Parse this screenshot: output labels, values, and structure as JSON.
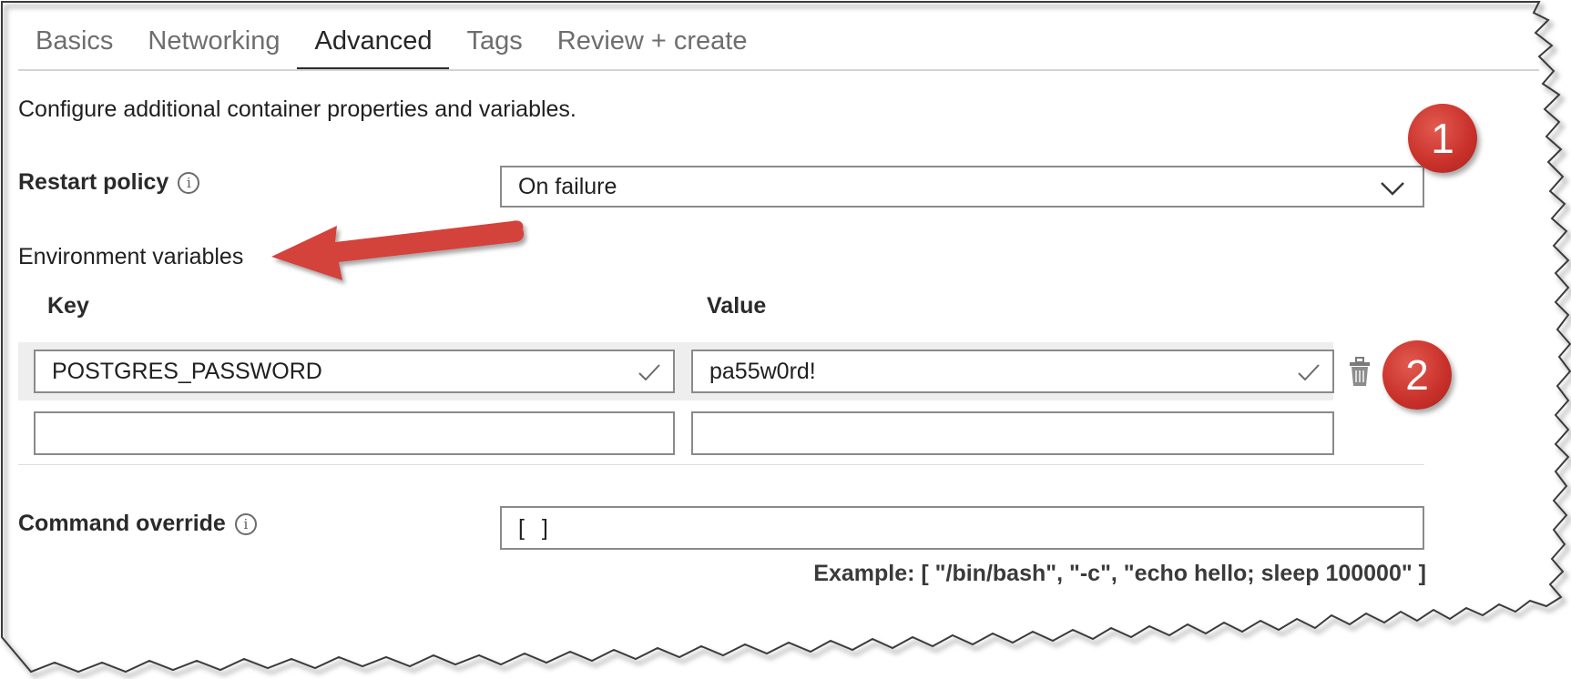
{
  "tabs": [
    {
      "label": "Basics",
      "active": false
    },
    {
      "label": "Networking",
      "active": false
    },
    {
      "label": "Advanced",
      "active": true
    },
    {
      "label": "Tags",
      "active": false
    },
    {
      "label": "Review + create",
      "active": false
    }
  ],
  "description": "Configure additional container properties and variables.",
  "restart_policy": {
    "label": "Restart policy",
    "value": "On failure"
  },
  "environment_variables": {
    "label": "Environment variables",
    "key_header": "Key",
    "value_header": "Value",
    "rows": [
      {
        "key": "POSTGRES_PASSWORD",
        "value": "pa55w0rd!"
      },
      {
        "key": "",
        "value": ""
      }
    ]
  },
  "command_override": {
    "label": "Command override",
    "value": "[ ]",
    "example": "Example: [ \"/bin/bash\", \"-c\", \"echo hello; sleep 100000\" ]"
  },
  "callouts": {
    "badge_1": "1",
    "badge_2": "2",
    "color": "#c8302a"
  },
  "colors": {
    "border": "#8a8a8a",
    "active_tab_underline": "#2b2b2b",
    "row_highlight": "#eeeeee"
  }
}
